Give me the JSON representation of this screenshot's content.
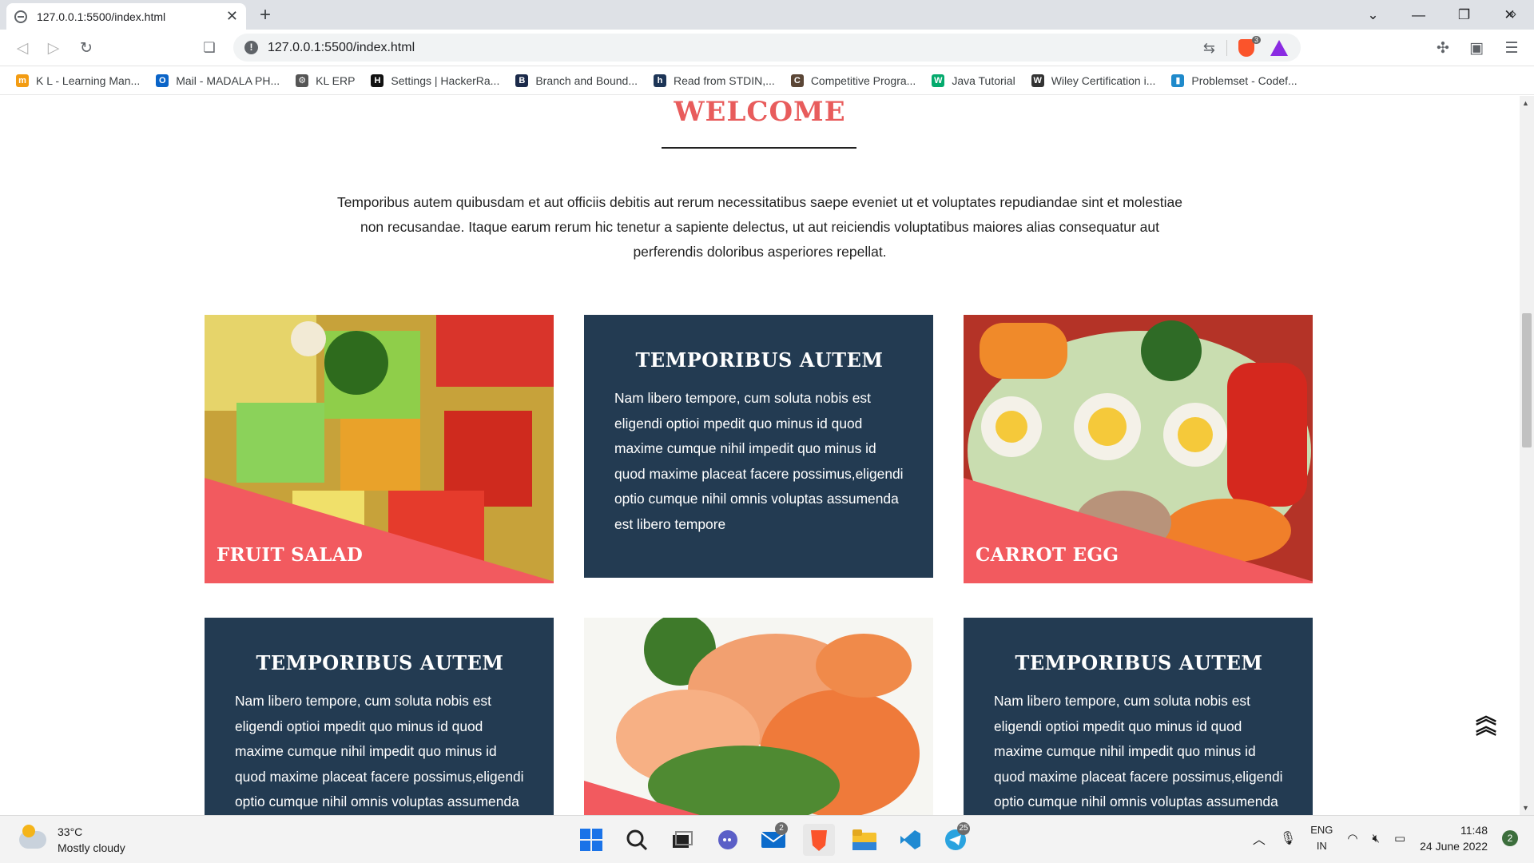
{
  "browser": {
    "tab_title": "127.0.0.1:5500/index.html",
    "url": "127.0.0.1:5500/index.html",
    "new_tab": "+",
    "tab_close": "✕",
    "brave_badge": "3"
  },
  "bookmarks": [
    {
      "label": "K L - Learning Man...",
      "icon": "kl-icon",
      "color": "#f39c12",
      "glyph": "m"
    },
    {
      "label": "Mail - MADALA PH...",
      "icon": "outlook-icon",
      "color": "#0a64c8",
      "glyph": "O"
    },
    {
      "label": "KL ERP",
      "icon": "gear-icon",
      "color": "#555555",
      "glyph": "⚙"
    },
    {
      "label": "Settings | HackerRa...",
      "icon": "hackerrank-icon",
      "color": "#111111",
      "glyph": "H"
    },
    {
      "label": "Branch and Bound...",
      "icon": "gfg-icon",
      "color": "#1b2a4a",
      "glyph": "B"
    },
    {
      "label": "Read from STDIN,...",
      "icon": "h-icon",
      "color": "#1d3557",
      "glyph": "h"
    },
    {
      "label": "Competitive Progra...",
      "icon": "cc-icon",
      "color": "#5b4636",
      "glyph": "C"
    },
    {
      "label": "Java Tutorial",
      "icon": "w3-icon",
      "color": "#04aa6d",
      "glyph": "W"
    },
    {
      "label": "Wiley Certification i...",
      "icon": "wiley-icon",
      "color": "#333333",
      "glyph": "W"
    },
    {
      "label": "Problemset - Codef...",
      "icon": "codeforces-icon",
      "color": "#1f8acb",
      "glyph": "▮"
    }
  ],
  "bookmarks_more": "»",
  "page": {
    "welcome": "WELCOME",
    "intro": "Temporibus autem quibusdam et aut officiis debitis aut rerum necessitatibus saepe eveniet ut et voluptates repudiandae sint et molestiae non recusandae. Itaque earum rerum hic tenetur a sapiente delectus, ut aut reiciendis voluptatibus maiores alias consequatur aut perferendis doloribus asperiores repellat.",
    "card_heading": "TEMPORIBUS AUTEM",
    "card_text": "Nam libero tempore, cum soluta nobis est eligendi optioi mpedit quo minus id quod maxime cumque nihil impedit quo minus id quod maxime placeat facere possimus,eligendi optio cumque nihil omnis voluptas assumenda est libero tempore",
    "fruit_salad": "FRUIT SALAD",
    "carrot_egg": "CARROT EGG"
  },
  "taskbar": {
    "temperature": "33°C",
    "condition": "Mostly cloudy",
    "mail_badge": "2",
    "telegram_badge": "25",
    "lang": "ENG",
    "region": "IN",
    "time": "11:48",
    "date": "24 June 2022",
    "notifications": "2"
  }
}
